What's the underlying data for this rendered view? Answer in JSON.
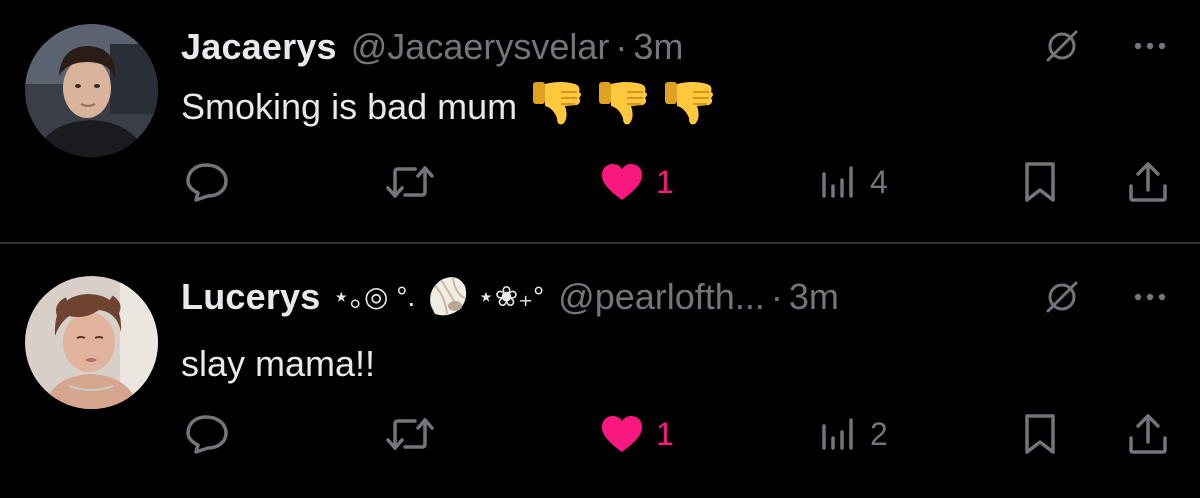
{
  "tweets": [
    {
      "name": "Jacaerys",
      "name_decoration": "",
      "handle": "@Jacaerysvelar",
      "separator": "·",
      "time": "3m",
      "text": "Smoking is bad mum",
      "emojis": [
        "thumbs-down",
        "thumbs-down",
        "thumbs-down"
      ],
      "likes": "1",
      "views": "4",
      "liked": true
    },
    {
      "name": "Lucerys",
      "name_deco_left": "⋆｡◎ °.",
      "name_deco_right": "⋆❀₊°",
      "handle": "@pearlofth...",
      "separator": "·",
      "time": "3m",
      "text": "slay mama!!",
      "likes": "1",
      "views": "2",
      "liked": true
    }
  ],
  "colors": {
    "background": "#000000",
    "text": "#e7e9ea",
    "muted": "#71767b",
    "like": "#f91880",
    "divider": "#2f3336"
  },
  "icons": {
    "reply": "reply-icon",
    "repost": "repost-icon",
    "like": "heart-icon",
    "views": "views-icon",
    "bookmark": "bookmark-icon",
    "share": "share-icon",
    "grok": "grok-icon",
    "more": "more-icon"
  }
}
